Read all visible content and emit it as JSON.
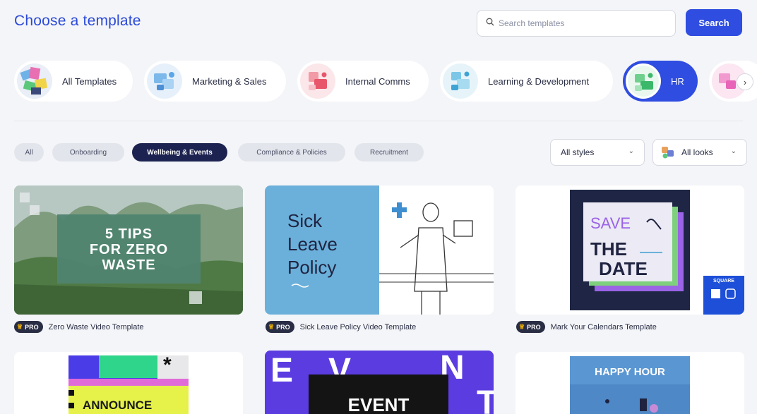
{
  "header": {
    "title": "Choose a template"
  },
  "search": {
    "placeholder": "Search templates",
    "button_label": "Search"
  },
  "categories": [
    {
      "label": "All Templates"
    },
    {
      "label": "Marketing & Sales"
    },
    {
      "label": "Internal Comms"
    },
    {
      "label": "Learning & Development"
    },
    {
      "label": "HR",
      "active": true
    }
  ],
  "filters": [
    {
      "label": "All"
    },
    {
      "label": "Onboarding"
    },
    {
      "label": "Wellbeing & Events",
      "active": true
    },
    {
      "label": "Compliance & Policies"
    },
    {
      "label": "Recruitment"
    }
  ],
  "dropdowns": {
    "styles": "All styles",
    "looks": "All looks"
  },
  "templates": [
    {
      "name": "Zero Waste Video Template",
      "badge": "PRO",
      "thumb_text": [
        "5 TIPS",
        "FOR ZERO",
        "WASTE"
      ]
    },
    {
      "name": "Sick Leave Policy Video Template",
      "badge": "PRO",
      "thumb_text": [
        "Sick",
        "Leave",
        "Policy"
      ]
    },
    {
      "name": "Mark Your Calendars Template",
      "badge": "PRO",
      "thumb_text": [
        "SAVE",
        "THE",
        "DATE"
      ],
      "format": "SQUARE"
    },
    {
      "name": "",
      "thumb_text": [
        "ANNOUNCE"
      ]
    },
    {
      "name": "",
      "thumb_text": [
        "EVENT"
      ]
    },
    {
      "name": "",
      "thumb_text": [
        "HAPPY HOUR"
      ]
    }
  ],
  "colors": {
    "accent": "#2f4de0",
    "navy": "#1c2350"
  }
}
